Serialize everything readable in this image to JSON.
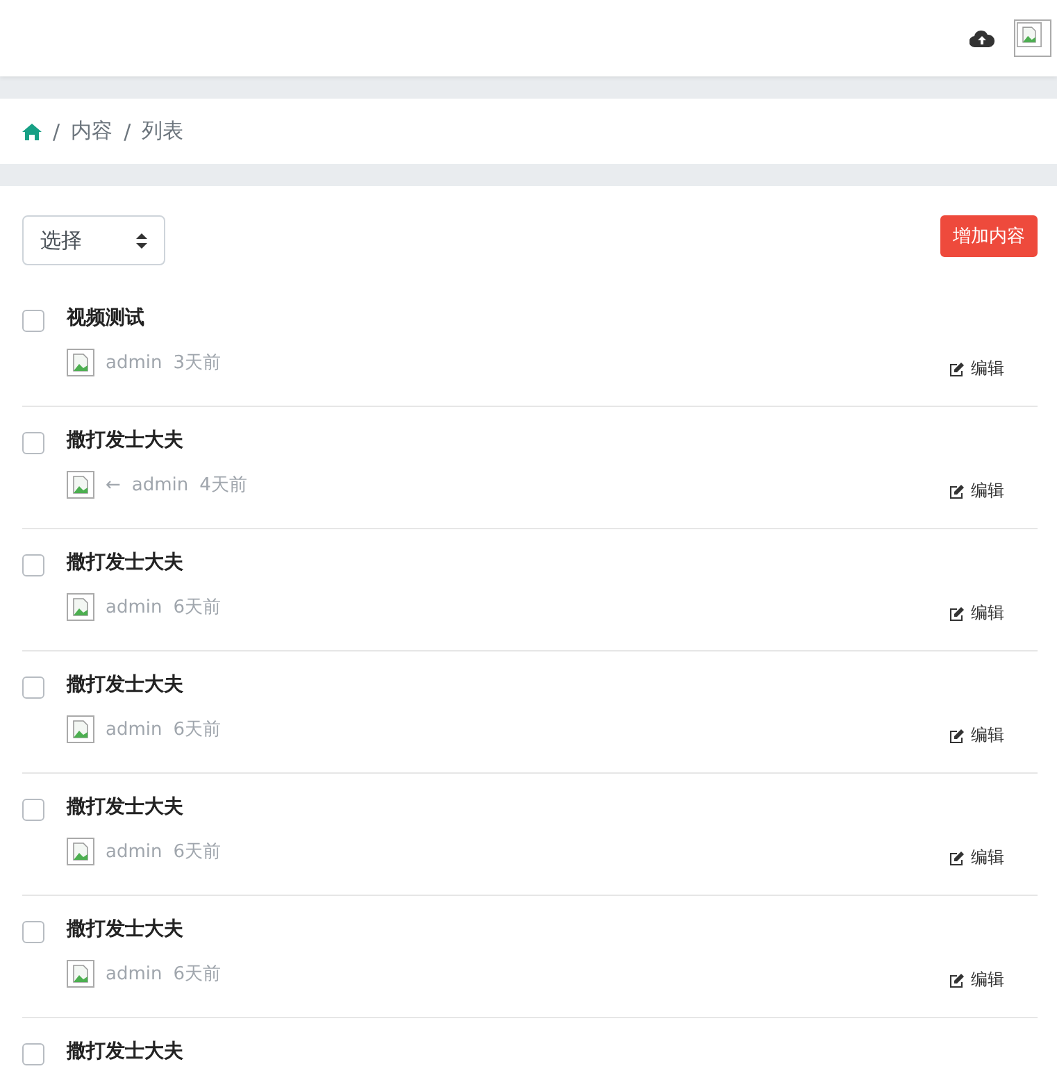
{
  "breadcrumb": [
    {
      "separator": "/",
      "label": "内容"
    },
    {
      "separator": "/",
      "label": "列表"
    }
  ],
  "select": {
    "value": "选择"
  },
  "add_button": "增加内容",
  "items": [
    {
      "title": "视频测试",
      "checked": false,
      "author": "admin",
      "time": "3天前",
      "edit": "编辑"
    },
    {
      "title": "撒打发士大夫",
      "checked": false,
      "arrow": "←",
      "author": "admin",
      "time": "4天前",
      "edit": "编辑"
    },
    {
      "title": "撒打发士大夫",
      "checked": false,
      "author": "admin",
      "time": "6天前",
      "edit": "编辑"
    },
    {
      "title": "撒打发士大夫",
      "checked": false,
      "author": "admin",
      "time": "6天前",
      "edit": "编辑"
    },
    {
      "title": "撒打发士大夫",
      "checked": false,
      "author": "admin",
      "time": "6天前",
      "edit": "编辑"
    },
    {
      "title": "撒打发士大夫",
      "checked": false,
      "author": "admin",
      "time": "6天前",
      "edit": "编辑"
    },
    {
      "title": "撒打发士大夫",
      "checked": false
    }
  ]
}
